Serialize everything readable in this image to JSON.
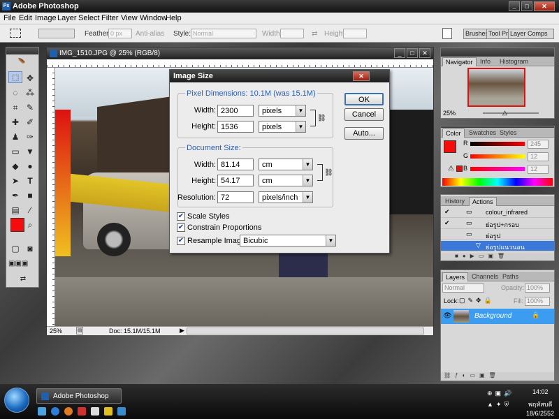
{
  "app": {
    "title": "Adobe Photoshop",
    "icon_text": "Ps"
  },
  "menu": [
    "File",
    "Edit",
    "Image",
    "Layer",
    "Select",
    "Filter",
    "View",
    "Window",
    "Help"
  ],
  "options_bar": {
    "feather_label": "Feather:",
    "feather_value": "0 px",
    "antialias_label": "Anti-alias",
    "style_label": "Style:",
    "style_value": "Normal",
    "width_label": "Width:",
    "height_label": "Height:",
    "dock_tabs": [
      "Brushes",
      "Tool Pr",
      "Layer Comps"
    ]
  },
  "document": {
    "title": "IMG_1510.JPG @ 25% (RGB/8)",
    "zoom": "25%",
    "doc_info": "Doc: 15.1M/15.1M"
  },
  "dialog": {
    "title": "Image Size",
    "pixel_dimensions_label": "Pixel Dimensions:",
    "pixel_dimensions_value": "10.1M (was 15.1M)",
    "px_width_label": "Width:",
    "px_width_value": "2300",
    "px_width_unit": "pixels",
    "px_height_label": "Height:",
    "px_height_value": "1536",
    "px_height_unit": "pixels",
    "document_size_label": "Document Size:",
    "doc_width_label": "Width:",
    "doc_width_value": "81.14",
    "doc_width_unit": "cm",
    "doc_height_label": "Height:",
    "doc_height_value": "54.17",
    "doc_height_unit": "cm",
    "resolution_label": "Resolution:",
    "resolution_value": "72",
    "resolution_unit": "pixels/inch",
    "scale_styles": "Scale Styles",
    "constrain_proportions": "Constrain Proportions",
    "resample_label": "Resample Image:",
    "resample_value": "Bicubic",
    "ok": "OK",
    "cancel": "Cancel",
    "auto": "Auto...",
    "scale_styles_checked": true,
    "constrain_checked": true,
    "resample_checked": true
  },
  "navigator": {
    "tabs": [
      "Navigator",
      "Info",
      "Histogram"
    ],
    "zoom": "25%"
  },
  "color": {
    "tabs": [
      "Color",
      "Swatches",
      "Styles"
    ],
    "r_label": "R",
    "r_value": "245",
    "g_label": "G",
    "g_value": "12",
    "b_label": "B",
    "b_value": "12",
    "foreground": "#f50c0c"
  },
  "actions": {
    "tabs": [
      "History",
      "Actions"
    ],
    "items": [
      "colour_infrared",
      "ย่อรูป+กรอบ",
      "ย่อรูป",
      "ย่อรูปแนวนอน"
    ]
  },
  "layers": {
    "tabs": [
      "Layers",
      "Channels",
      "Paths"
    ],
    "blend_mode": "Normal",
    "opacity_label": "Opacity:",
    "opacity_value": "100%",
    "lock_label": "Lock:",
    "fill_label": "Fill:",
    "fill_value": "100%",
    "layer_name": "Background"
  },
  "taskbar": {
    "task": "Adobe Photoshop",
    "time": "14:02",
    "day": "พฤหัสบดี",
    "date": "18/6/2552"
  }
}
